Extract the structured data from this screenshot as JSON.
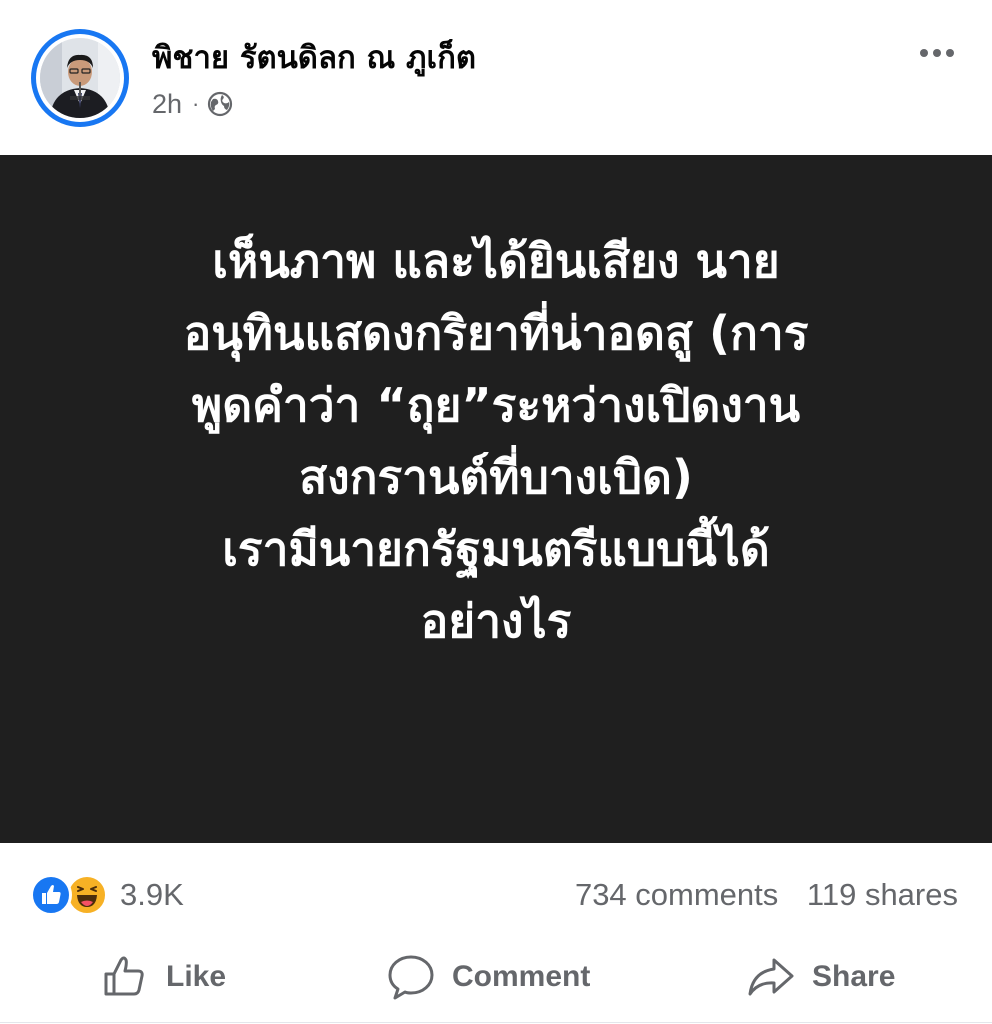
{
  "post": {
    "author_name": "พิชาย รัตนดิลก ณ ภูเก็ต",
    "time": "2h",
    "separator": "·",
    "privacy_icon": "globe-icon",
    "more_icon": "more-options-icon"
  },
  "card": {
    "background": "#1f1f1f",
    "text_color": "#ffffff",
    "lines": [
      "เห็นภาพ และได้ยินเสียง นาย",
      "อนุทินแสดงกริยาที่น่าอดสู (การ",
      "พูดคำว่า “ถุย”ระหว่างเปิดงาน",
      "สงกรานต์ที่บางเบิด)",
      "เรามีนายกรัฐมนตรีแบบนี้ได้",
      "อย่างไร"
    ]
  },
  "engagement": {
    "reactions": [
      "like-reaction-icon",
      "haha-reaction-icon"
    ],
    "reaction_count": "3.9K",
    "comments": "734 comments",
    "shares": "119 shares"
  },
  "actions": {
    "like_label": "Like",
    "comment_label": "Comment",
    "share_label": "Share"
  },
  "colors": {
    "accent": "#1877f2",
    "secondary_text": "#65676b",
    "haha_yellow": "#f7b125"
  }
}
